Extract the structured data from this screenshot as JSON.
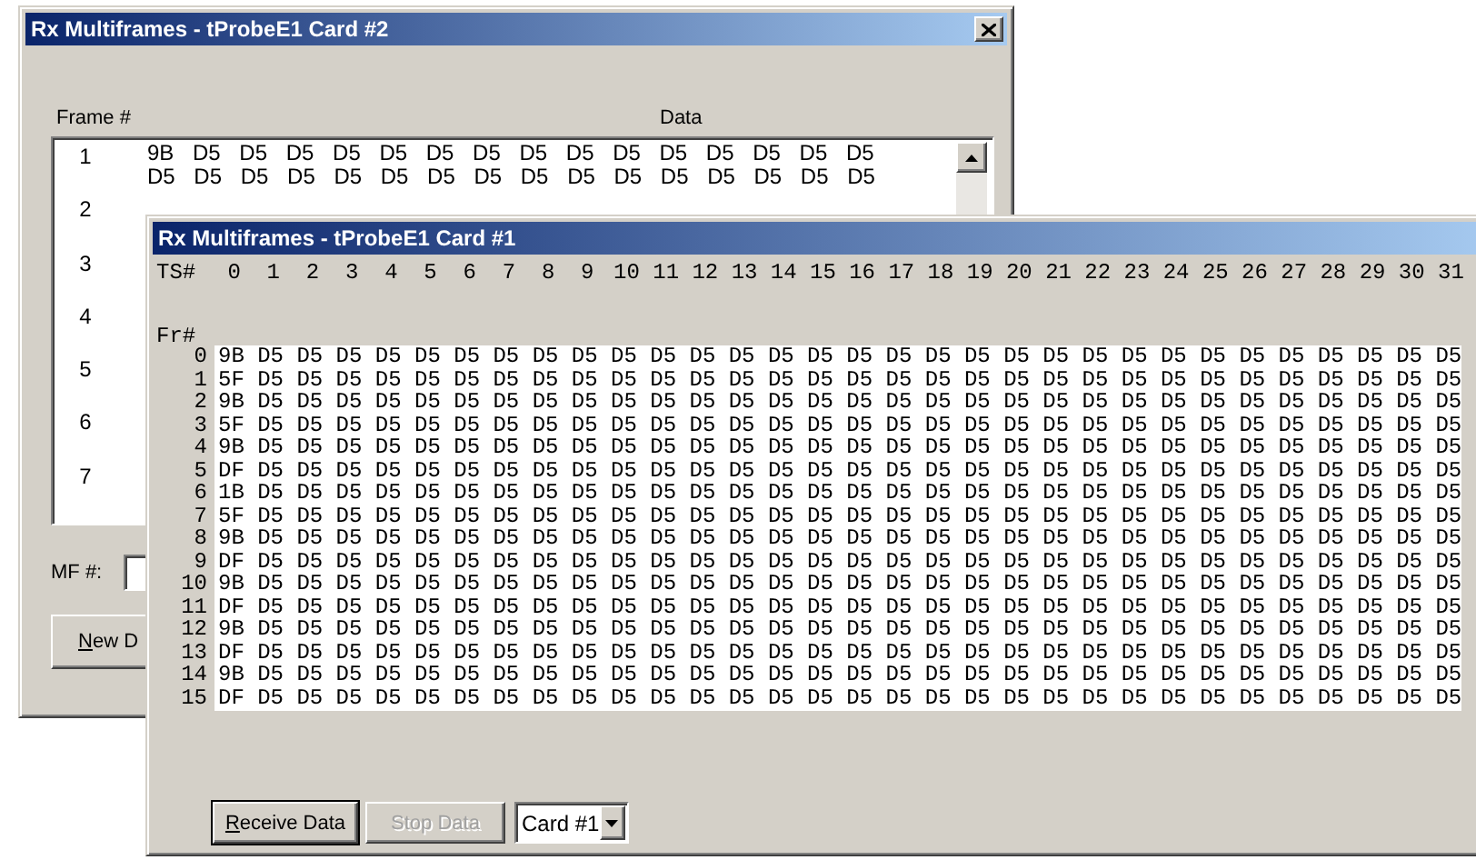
{
  "back_window": {
    "title": "Rx Multiframes - tProbeE1 Card #2",
    "columns": [
      "Frame #",
      "Data"
    ],
    "frames": [
      {
        "number": "1",
        "lines": [
          "9B D5 D5 D5 D5 D5 D5 D5 D5 D5 D5 D5 D5 D5 D5 D5",
          "D5 D5 D5 D5 D5 D5 D5 D5 D5 D5 D5 D5 D5 D5 D5 D5"
        ]
      },
      {
        "number": "2"
      },
      {
        "number": "3"
      },
      {
        "number": "4"
      },
      {
        "number": "5"
      },
      {
        "number": "6"
      },
      {
        "number": "7"
      }
    ],
    "mf_label": "MF #:",
    "button": "New D"
  },
  "front_window": {
    "title": "Rx Multiframes - tProbeE1 Card #1",
    "ts_label": "TS#",
    "timeslots": [
      "0",
      "1",
      "2",
      "3",
      "4",
      "5",
      "6",
      "7",
      "8",
      "9",
      "10",
      "11",
      "12",
      "13",
      "14",
      "15",
      "16",
      "17",
      "18",
      "19",
      "20",
      "21",
      "22",
      "23",
      "24",
      "25",
      "26",
      "27",
      "28",
      "29",
      "30",
      "31"
    ],
    "fr_label": "Fr#",
    "rows": [
      {
        "frame": "0",
        "data": "9B D5 D5 D5 D5 D5 D5 D5 D5 D5 D5 D5 D5 D5 D5 D5 D5 D5 D5 D5 D5 D5 D5 D5 D5 D5 D5 D5 D5 D5 D5 D5"
      },
      {
        "frame": "1",
        "data": "5F D5 D5 D5 D5 D5 D5 D5 D5 D5 D5 D5 D5 D5 D5 D5 D5 D5 D5 D5 D5 D5 D5 D5 D5 D5 D5 D5 D5 D5 D5 D5"
      },
      {
        "frame": "2",
        "data": "9B D5 D5 D5 D5 D5 D5 D5 D5 D5 D5 D5 D5 D5 D5 D5 D5 D5 D5 D5 D5 D5 D5 D5 D5 D5 D5 D5 D5 D5 D5 D5"
      },
      {
        "frame": "3",
        "data": "5F D5 D5 D5 D5 D5 D5 D5 D5 D5 D5 D5 D5 D5 D5 D5 D5 D5 D5 D5 D5 D5 D5 D5 D5 D5 D5 D5 D5 D5 D5 D5"
      },
      {
        "frame": "4",
        "data": "9B D5 D5 D5 D5 D5 D5 D5 D5 D5 D5 D5 D5 D5 D5 D5 D5 D5 D5 D5 D5 D5 D5 D5 D5 D5 D5 D5 D5 D5 D5 D5"
      },
      {
        "frame": "5",
        "data": "DF D5 D5 D5 D5 D5 D5 D5 D5 D5 D5 D5 D5 D5 D5 D5 D5 D5 D5 D5 D5 D5 D5 D5 D5 D5 D5 D5 D5 D5 D5 D5"
      },
      {
        "frame": "6",
        "data": "1B D5 D5 D5 D5 D5 D5 D5 D5 D5 D5 D5 D5 D5 D5 D5 D5 D5 D5 D5 D5 D5 D5 D5 D5 D5 D5 D5 D5 D5 D5 D5"
      },
      {
        "frame": "7",
        "data": "5F D5 D5 D5 D5 D5 D5 D5 D5 D5 D5 D5 D5 D5 D5 D5 D5 D5 D5 D5 D5 D5 D5 D5 D5 D5 D5 D5 D5 D5 D5 D5"
      },
      {
        "frame": "8",
        "data": "9B D5 D5 D5 D5 D5 D5 D5 D5 D5 D5 D5 D5 D5 D5 D5 D5 D5 D5 D5 D5 D5 D5 D5 D5 D5 D5 D5 D5 D5 D5 D5"
      },
      {
        "frame": "9",
        "data": "DF D5 D5 D5 D5 D5 D5 D5 D5 D5 D5 D5 D5 D5 D5 D5 D5 D5 D5 D5 D5 D5 D5 D5 D5 D5 D5 D5 D5 D5 D5 D5"
      },
      {
        "frame": "10",
        "data": "9B D5 D5 D5 D5 D5 D5 D5 D5 D5 D5 D5 D5 D5 D5 D5 D5 D5 D5 D5 D5 D5 D5 D5 D5 D5 D5 D5 D5 D5 D5 D5"
      },
      {
        "frame": "11",
        "data": "DF D5 D5 D5 D5 D5 D5 D5 D5 D5 D5 D5 D5 D5 D5 D5 D5 D5 D5 D5 D5 D5 D5 D5 D5 D5 D5 D5 D5 D5 D5 D5"
      },
      {
        "frame": "12",
        "data": "9B D5 D5 D5 D5 D5 D5 D5 D5 D5 D5 D5 D5 D5 D5 D5 D5 D5 D5 D5 D5 D5 D5 D5 D5 D5 D5 D5 D5 D5 D5 D5"
      },
      {
        "frame": "13",
        "data": "DF D5 D5 D5 D5 D5 D5 D5 D5 D5 D5 D5 D5 D5 D5 D5 D5 D5 D5 D5 D5 D5 D5 D5 D5 D5 D5 D5 D5 D5 D5 D5"
      },
      {
        "frame": "14",
        "data": "9B D5 D5 D5 D5 D5 D5 D5 D5 D5 D5 D5 D5 D5 D5 D5 D5 D5 D5 D5 D5 D5 D5 D5 D5 D5 D5 D5 D5 D5 D5 D5"
      },
      {
        "frame": "15",
        "data": "DF D5 D5 D5 D5 D5 D5 D5 D5 D5 D5 D5 D5 D5 D5 D5 D5 D5 D5 D5 D5 D5 D5 D5 D5 D5 D5 D5 D5 D5 D5 D5"
      }
    ],
    "buttons": [
      {
        "label": "Receive Data",
        "default": true,
        "disabled": false
      },
      {
        "label": "Stop Data",
        "default": false,
        "disabled": true
      }
    ],
    "card_select": "Card #1"
  }
}
